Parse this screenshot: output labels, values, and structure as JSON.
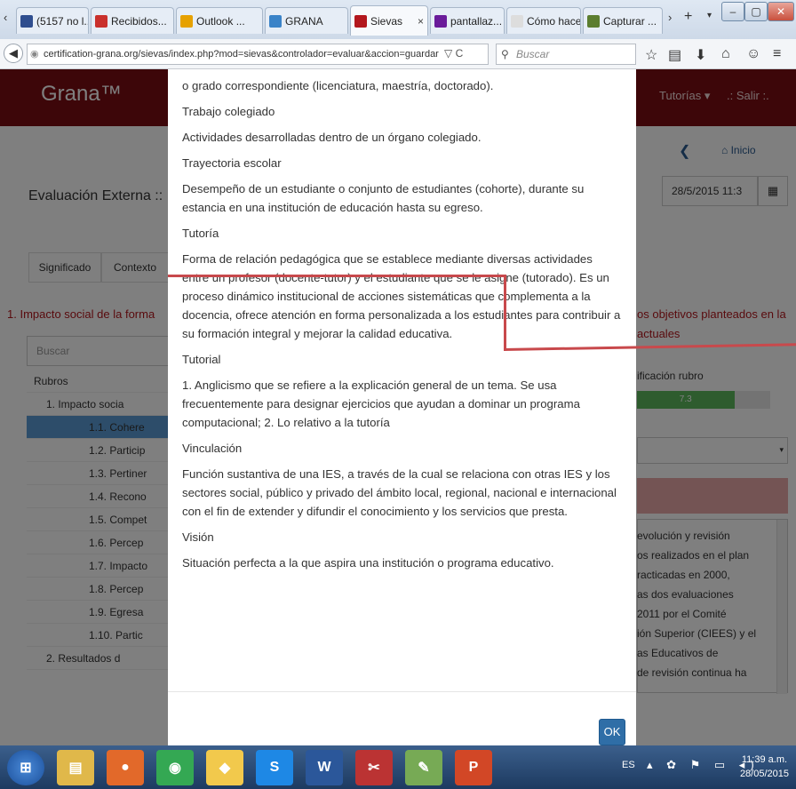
{
  "browser": {
    "tabs": [
      {
        "label": "(5157 no l...",
        "icon_color": "#2f4e8f"
      },
      {
        "label": "Recibidos...",
        "icon_color": "#c9302c"
      },
      {
        "label": "Outlook ...",
        "icon_color": "#e6a100"
      },
      {
        "label": "GRANA",
        "icon_color": "#3a83c8"
      },
      {
        "label": "Sievas",
        "icon_color": "#b3171d",
        "active": true
      },
      {
        "label": "pantallaz...",
        "icon_color": "#6a1b9a"
      },
      {
        "label": "Cómo hacer ...",
        "icon_color": "#dddddd"
      },
      {
        "label": "Capturar ...",
        "icon_color": "#5b7d2f"
      }
    ],
    "url": "certification-grana.org/sievas/index.php?mod=sievas&controlador=evaluar&accion=guardar",
    "search_placeholder": "Buscar",
    "window_buttons": [
      "–",
      "▢",
      "✕"
    ]
  },
  "app": {
    "logo": "Grana™",
    "nav": [
      "Tutorías ▾",
      ".: Salir :."
    ],
    "inicio": "Inicio",
    "page_title": "Evaluación Externa :: I",
    "date_value": "28/5/2015 11:3",
    "tabs": [
      "Significado",
      "Contexto"
    ],
    "section_title": "1. Impacto social de la forma",
    "section_right": "os objetivos planteados en la",
    "section_right2": "actuales",
    "search_placeholder": "Buscar",
    "calif_label": "ificación rubro",
    "calif_value": "7.3",
    "calif_percent": 73,
    "tree": [
      "Rubros",
      "1. Impacto socia",
      "1.1. Cohere",
      "1.2. Particip",
      "1.3. Pertiner",
      "1.4. Recono",
      "1.5. Compet",
      "1.6. Percep",
      "1.7. Impacto",
      "1.8. Percep",
      "1.9. Egresa",
      "1.10. Partic",
      "2. Resultados d"
    ],
    "right_text": [
      "evolución y revisión",
      "os realizados en el plan",
      "racticadas en 2000,",
      "as dos evaluaciones",
      "2011 por el Comité",
      "ión Superior (CIEES) y el",
      "as Educativos de",
      "de revisión continua ha"
    ]
  },
  "modal": {
    "entries": [
      {
        "term": "",
        "def": "o grado correspondiente (licenciatura, maestría, doctorado)."
      },
      {
        "term": "Trabajo colegiado",
        "def": "Actividades desarrolladas dentro de un órgano colegiado."
      },
      {
        "term": "Trayectoria escolar",
        "def": "Desempeño de un estudiante o conjunto de estudiantes (cohorte), durante su estancia en una institución de educación hasta su egreso."
      },
      {
        "term": "Tutoría",
        "def": "Forma de relación pedagógica que se establece mediante diversas actividades entre un profesor (docente-tutor) y el estudiante que se le asigne (tutorado). Es un proceso dinámico institucional de acciones sistemáticas que complementa a la docencia, ofrece atención en forma personalizada a los estudiantes para contribuir a su formación integral y mejorar la calidad educativa."
      },
      {
        "term": "Tutorial",
        "def": "1. Anglicismo que se refiere a la explicación general de un tema. Se usa frecuentemente para designar ejercicios que ayudan a dominar un programa computacional; 2. Lo relativo a la tutoría"
      },
      {
        "term": "Vinculación",
        "def": "Función sustantiva de una IES, a través de la cual se relaciona con otras IES y los sectores social, público y privado del ámbito local, regional, nacional e internacional con el fin de extender y difundir el conocimiento y los servicios que presta."
      },
      {
        "term": "Visión",
        "def": "Situación perfecta a la que aspira una institución o programa educativo."
      }
    ],
    "ok_label": "OK"
  },
  "taskbar": {
    "lang": "ES",
    "time": "11:39 a.m.",
    "date": "28/05/2015",
    "apps": [
      "windows",
      "explorer",
      "firefox",
      "chrome",
      "folder",
      "skype",
      "word",
      "snip",
      "paint",
      "powerpoint"
    ]
  }
}
